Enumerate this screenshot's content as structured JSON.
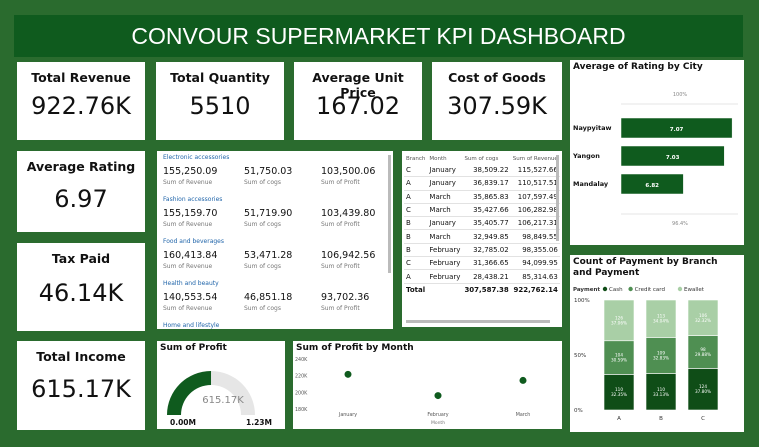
{
  "title": "CONVOUR SUPERMARKET KPI DASHBOARD",
  "kpis": {
    "total_revenue": {
      "label": "Total Revenue",
      "value": "922.76K"
    },
    "total_quantity": {
      "label": "Total Quantity",
      "value": "5510"
    },
    "avg_unit_price": {
      "label": "Average Unit Price",
      "value": "167.02"
    },
    "cost_of_goods": {
      "label": "Cost of Goods",
      "value": "307.59K"
    },
    "avg_rating": {
      "label": "Average Rating",
      "value": "6.97"
    },
    "tax_paid": {
      "label": "Tax Paid",
      "value": "46.14K"
    },
    "total_income": {
      "label": "Total Income",
      "value": "615.17K"
    }
  },
  "categories": [
    {
      "name": "Electronic accessories",
      "revenue": "155,250.09",
      "cogs": "51,750.03",
      "profit": "103,500.06"
    },
    {
      "name": "Fashion accessories",
      "revenue": "155,159.70",
      "cogs": "51,719.90",
      "profit": "103,439.80"
    },
    {
      "name": "Food and beverages",
      "revenue": "160,413.84",
      "cogs": "53,471.28",
      "profit": "106,942.56"
    },
    {
      "name": "Health and beauty",
      "revenue": "140,553.54",
      "cogs": "46,851.18",
      "profit": "93,702.36"
    }
  ],
  "category_labels": {
    "revenue": "Sum of Revenue",
    "cogs": "Sum of cogs",
    "profit": "Sum of Profit",
    "partial_next": "Home and lifestyle"
  },
  "table": {
    "headers": [
      "Branch",
      "Month",
      "Sum of cogs",
      "Sum of Revenue"
    ],
    "rows": [
      [
        "C",
        "January",
        "38,509.22",
        "115,527.66"
      ],
      [
        "A",
        "January",
        "36,839.17",
        "110,517.51"
      ],
      [
        "A",
        "March",
        "35,865.83",
        "107,597.49"
      ],
      [
        "C",
        "March",
        "35,427.66",
        "106,282.98"
      ],
      [
        "B",
        "January",
        "35,405.77",
        "106,217.31"
      ],
      [
        "B",
        "March",
        "32,949.85",
        "98,849.55"
      ],
      [
        "B",
        "February",
        "32,785.02",
        "98,355.06"
      ],
      [
        "C",
        "February",
        "31,366.65",
        "94,099.95"
      ],
      [
        "A",
        "February",
        "28,438.21",
        "85,314.63"
      ]
    ],
    "total": [
      "Total",
      "",
      "307,587.38",
      "922,762.14"
    ]
  },
  "chart_data": [
    {
      "type": "bar",
      "title": "Average of Rating by City",
      "orientation": "horizontal",
      "categories": [
        "Naypyitaw",
        "Yangon",
        "Mandalay"
      ],
      "values": [
        7.07,
        7.03,
        6.82
      ],
      "value_labels": [
        "7.07",
        "7.03",
        "6.82"
      ],
      "top_axis_label": "100%",
      "bottom_axis_label": "96.4%",
      "color": "#0f5b1e"
    },
    {
      "type": "bar",
      "stacked": "100%",
      "title": "Count of Payment by Branch and Payment",
      "legend_title": "Payment",
      "legend_position": "top",
      "categories": [
        "A",
        "B",
        "C"
      ],
      "series": [
        {
          "name": "Cash",
          "color": "#0f4d17",
          "values": [
            110,
            110,
            124
          ],
          "labels": [
            "110\n32.35%",
            "110\n33.13%",
            "124\n37.80%"
          ]
        },
        {
          "name": "Credit card",
          "color": "#4f8f52",
          "values": [
            104,
            109,
            98
          ],
          "labels": [
            "104\n30.59%",
            "109\n32.83%",
            "98\n29.88%"
          ]
        },
        {
          "name": "Ewallet",
          "color": "#a9cfa6",
          "values": [
            126,
            113,
            106
          ],
          "labels": [
            "126\n37.06%",
            "113\n34.04%",
            "106\n32.32%"
          ]
        }
      ],
      "y_ticks": [
        "100%",
        "50%",
        "0%"
      ]
    },
    {
      "type": "gauge",
      "title": "Sum of Profit",
      "value": 615.17,
      "value_label": "615.17K",
      "min_label": "0.00M",
      "max_label": "1.23M",
      "min": 0,
      "max": 1230,
      "color": "#0f5b1e"
    },
    {
      "type": "scatter",
      "title": "Sum of Profit by Month",
      "categories": [
        "January",
        "February",
        "March"
      ],
      "values": [
        221.6,
        196.1,
        214.3
      ],
      "y_ticks": [
        "240K",
        "220K",
        "200K",
        "180K"
      ],
      "ylim": [
        180,
        240
      ],
      "xlabel": "Month",
      "color": "#0f5b1e"
    }
  ]
}
